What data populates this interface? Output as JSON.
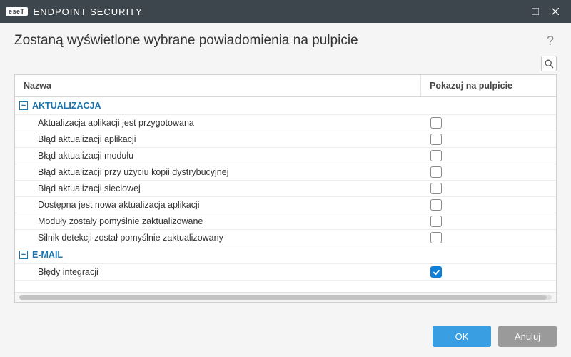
{
  "titlebar": {
    "logo": "eseT",
    "title": "ENDPOINT SECURITY"
  },
  "header": {
    "heading": "Zostaną wyświetlone wybrane powiadomienia na pulpicie"
  },
  "table": {
    "col_name": "Nazwa",
    "col_show": "Pokazuj na pulpicie"
  },
  "groups": [
    {
      "label": "AKTUALIZACJA",
      "expanded": true,
      "items": [
        {
          "label": "Aktualizacja aplikacji jest przygotowana",
          "checked": false
        },
        {
          "label": "Błąd aktualizacji aplikacji",
          "checked": false
        },
        {
          "label": "Błąd aktualizacji modułu",
          "checked": false
        },
        {
          "label": "Błąd aktualizacji przy użyciu kopii dystrybucyjnej",
          "checked": false
        },
        {
          "label": "Błąd aktualizacji sieciowej",
          "checked": false
        },
        {
          "label": "Dostępna jest nowa aktualizacja aplikacji",
          "checked": false
        },
        {
          "label": "Moduły zostały pomyślnie zaktualizowane",
          "checked": false
        },
        {
          "label": "Silnik detekcji został pomyślnie zaktualizowany",
          "checked": false
        }
      ]
    },
    {
      "label": "E-MAIL",
      "expanded": true,
      "items": [
        {
          "label": "Błędy integracji",
          "checked": true
        }
      ]
    }
  ],
  "footer": {
    "ok": "OK",
    "cancel": "Anuluj"
  }
}
